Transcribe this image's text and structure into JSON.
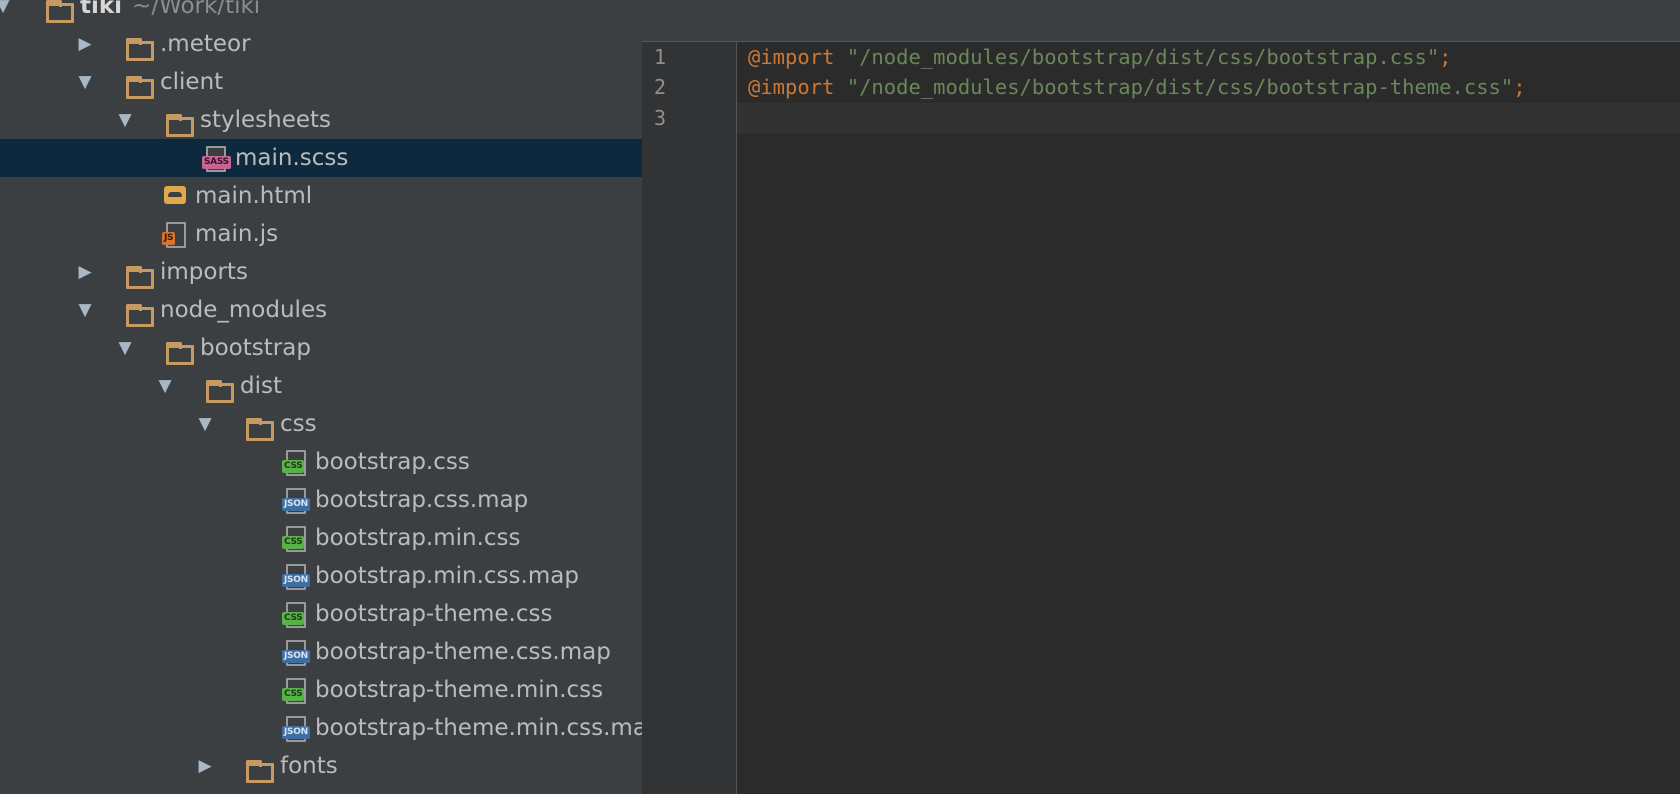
{
  "tree": {
    "root": {
      "name": "tiki",
      "path": "~/Work/tiki"
    },
    "items": [
      {
        "label": "tiki",
        "type": "folder",
        "depth": 0,
        "expanded": true
      },
      {
        "label": ".meteor",
        "type": "folder",
        "depth": 1,
        "expanded": false
      },
      {
        "label": "client",
        "type": "folder",
        "depth": 1,
        "expanded": true
      },
      {
        "label": "stylesheets",
        "type": "folder",
        "depth": 2,
        "expanded": true
      },
      {
        "label": "main.scss",
        "type": "file",
        "badge": "SASS",
        "depth": 3,
        "selected": true
      },
      {
        "label": "main.html",
        "type": "file",
        "badge": "HTML",
        "depth": 2
      },
      {
        "label": "main.js",
        "type": "file",
        "badge": "JS",
        "depth": 2
      },
      {
        "label": "imports",
        "type": "folder",
        "depth": 1,
        "expanded": false
      },
      {
        "label": "node_modules",
        "type": "folder",
        "depth": 1,
        "expanded": true
      },
      {
        "label": "bootstrap",
        "type": "folder",
        "depth": 2,
        "expanded": true
      },
      {
        "label": "dist",
        "type": "folder",
        "depth": 3,
        "expanded": true
      },
      {
        "label": "css",
        "type": "folder",
        "depth": 4,
        "expanded": true
      },
      {
        "label": "bootstrap.css",
        "type": "file",
        "badge": "CSS",
        "depth": 5
      },
      {
        "label": "bootstrap.css.map",
        "type": "file",
        "badge": "JSON",
        "depth": 5
      },
      {
        "label": "bootstrap.min.css",
        "type": "file",
        "badge": "CSS",
        "depth": 5
      },
      {
        "label": "bootstrap.min.css.map",
        "type": "file",
        "badge": "JSON",
        "depth": 5
      },
      {
        "label": "bootstrap-theme.css",
        "type": "file",
        "badge": "CSS",
        "depth": 5
      },
      {
        "label": "bootstrap-theme.css.map",
        "type": "file",
        "badge": "JSON",
        "depth": 5
      },
      {
        "label": "bootstrap-theme.min.css",
        "type": "file",
        "badge": "CSS",
        "depth": 5
      },
      {
        "label": "bootstrap-theme.min.css.map",
        "type": "file",
        "badge": "JSON",
        "depth": 5
      },
      {
        "label": "fonts",
        "type": "folder",
        "depth": 4,
        "expanded": false
      }
    ]
  },
  "editor": {
    "line_numbers": [
      "1",
      "2",
      "3"
    ],
    "lines": [
      {
        "keyword": "@import",
        "string": "\"/node_modules/bootstrap/dist/css/bootstrap.css\"",
        "end": ";"
      },
      {
        "keyword": "@import",
        "string": "\"/node_modules/bootstrap/dist/css/bootstrap-theme.css\"",
        "end": ";"
      },
      {
        "keyword": "",
        "string": "",
        "end": ""
      }
    ]
  },
  "colors": {
    "tree_bg": "#3c3f41",
    "selection": "#0d293e",
    "editor_bg": "#2b2b2b",
    "keyword": "#cc7832",
    "string": "#6a8759",
    "folder": "#c69a61"
  }
}
